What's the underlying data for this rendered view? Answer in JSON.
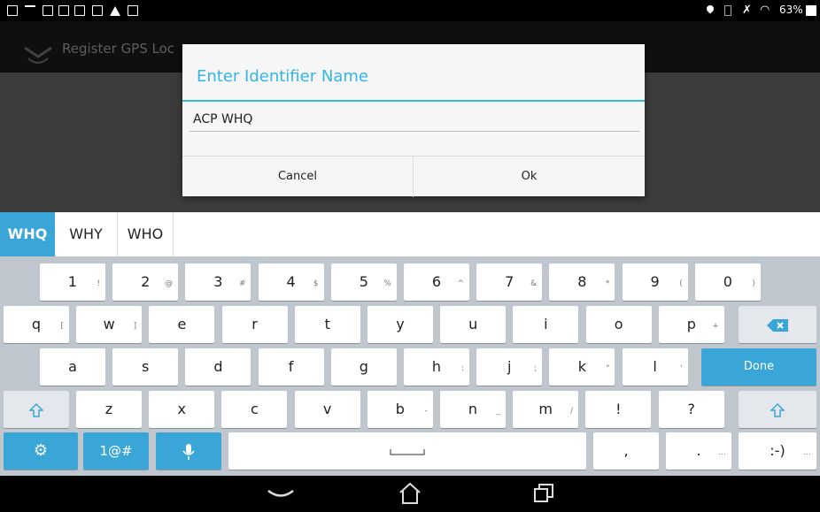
{
  "statusbar": {
    "battery_text": "63%"
  },
  "app": {
    "title": "Register GPS Loc"
  },
  "dialog": {
    "title": "Enter Identifier Name",
    "input_value": "ACP WHQ",
    "cancel_label": "Cancel",
    "ok_label": "Ok"
  },
  "suggestions": [
    "WHQ",
    "WHY",
    "WHO"
  ],
  "keyboard": {
    "rows": [
      [
        {
          "l": "1",
          "h": "!"
        },
        {
          "l": "2",
          "h": "@"
        },
        {
          "l": "3",
          "h": "#"
        },
        {
          "l": "4",
          "h": "$"
        },
        {
          "l": "5",
          "h": "%"
        },
        {
          "l": "6",
          "h": "^"
        },
        {
          "l": "7",
          "h": "&"
        },
        {
          "l": "8",
          "h": "*"
        },
        {
          "l": "9",
          "h": "("
        },
        {
          "l": "0",
          "h": ")"
        }
      ],
      [
        {
          "l": "q",
          "h": "["
        },
        {
          "l": "w",
          "h": "]"
        },
        {
          "l": "e",
          "h": ""
        },
        {
          "l": "r",
          "h": ""
        },
        {
          "l": "t",
          "h": ""
        },
        {
          "l": "y",
          "h": ""
        },
        {
          "l": "u",
          "h": ""
        },
        {
          "l": "i",
          "h": ""
        },
        {
          "l": "o",
          "h": ""
        },
        {
          "l": "p",
          "h": "+"
        }
      ],
      [
        {
          "l": "a",
          "h": ""
        },
        {
          "l": "s",
          "h": ""
        },
        {
          "l": "d",
          "h": ""
        },
        {
          "l": "f",
          "h": ""
        },
        {
          "l": "g",
          "h": ""
        },
        {
          "l": "h",
          "h": ":"
        },
        {
          "l": "j",
          "h": ";"
        },
        {
          "l": "k",
          "h": "\""
        },
        {
          "l": "l",
          "h": "'"
        }
      ],
      [
        {
          "l": "z",
          "h": ""
        },
        {
          "l": "x",
          "h": ""
        },
        {
          "l": "c",
          "h": ""
        },
        {
          "l": "v",
          "h": ""
        },
        {
          "l": "b",
          "h": "-"
        },
        {
          "l": "n",
          "h": "_"
        },
        {
          "l": "m",
          "h": "/"
        },
        {
          "l": "!",
          "h": ""
        },
        {
          "l": "?",
          "h": ""
        }
      ]
    ],
    "done_label": "Done",
    "symbols_label": "1@#",
    "comma_label": ",",
    "period_label": ".",
    "period_hint": "...",
    "smiley_label": ":-)",
    "smiley_hint": "..."
  },
  "colors": {
    "accent": "#33b5e5",
    "key_blue": "#3aa6d8"
  }
}
